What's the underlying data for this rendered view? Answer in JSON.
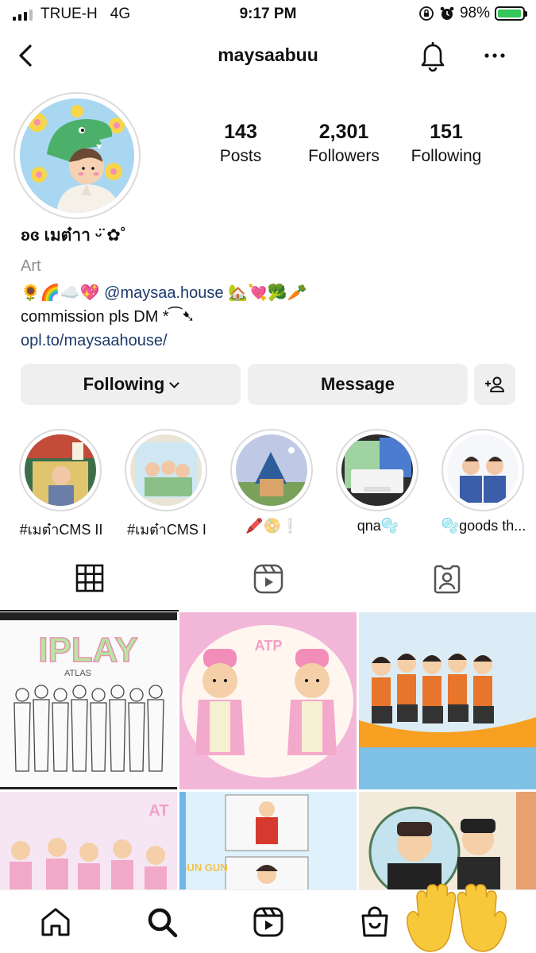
{
  "status_bar": {
    "carrier": "TRUE-H",
    "network": "4G",
    "time": "9:17 PM",
    "battery": "98%",
    "battery_level": 0.98
  },
  "header": {
    "username": "maysaabuu",
    "icons": [
      "back-icon",
      "bell-icon",
      "more-icon"
    ]
  },
  "profile": {
    "stats": [
      {
        "value": "143",
        "label": "Posts"
      },
      {
        "value": "2,301",
        "label": "Followers"
      },
      {
        "value": "151",
        "label": "Following"
      }
    ],
    "display_name": "ʚɞ เมต๋าา ᵕ̈ ✿˚",
    "category": "Art",
    "bio_line1_prefix": "🌻🌈☁️💖 ",
    "bio_mention": "@maysaa.house",
    "bio_line1_suffix": " 🏡💘🥦🥕",
    "bio_line2": "commission pls DM *⁀➷",
    "link": "opl.to/maysaahouse/"
  },
  "buttons": {
    "following": "Following",
    "message": "Message",
    "add_person_icon": "add-person-icon"
  },
  "highlights": [
    {
      "caption": "#เมต๋าCMS II"
    },
    {
      "caption": "#เมต๋าCMS I"
    },
    {
      "caption": "🖍️📀❕"
    },
    {
      "caption": "qna🫧"
    },
    {
      "caption": "🫧goods th..."
    }
  ],
  "tabs": [
    {
      "icon": "grid-icon",
      "selected": true
    },
    {
      "icon": "reels-icon",
      "selected": false
    },
    {
      "icon": "tagged-icon",
      "selected": false
    }
  ],
  "posts": {
    "post1_title": "IPLAY",
    "post1_subtitle": "ATLAS",
    "post2_letters": "ATP",
    "post4_letters": "AT",
    "post5_text": "GUN GUN"
  },
  "bottom_nav": [
    "home-icon",
    "search-icon",
    "reels-icon",
    "shop-icon",
    "waving-hands-emoji"
  ],
  "colors": {
    "link": "#1b3a6b",
    "button_bg": "#efefef",
    "battery": "#34c759"
  }
}
